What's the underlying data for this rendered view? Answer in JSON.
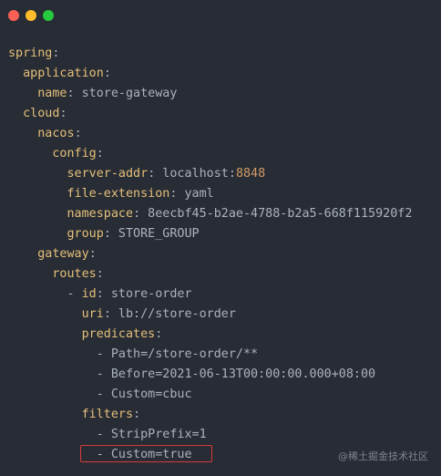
{
  "window": {
    "dots": [
      {
        "name": "close",
        "color": "#ff5f56"
      },
      {
        "name": "minimize",
        "color": "#ffbd2e"
      },
      {
        "name": "maximize",
        "color": "#27c93f"
      }
    ]
  },
  "colors": {
    "background": "#282c34",
    "key": "#e5c07b",
    "number": "#d19a66",
    "text": "#abb2bf",
    "highlight_border": "#d93a3a"
  },
  "code": {
    "lines": [
      {
        "indent": "",
        "parts": [
          {
            "t": "spring",
            "c": "key"
          },
          {
            "t": ":",
            "c": "val"
          }
        ]
      },
      {
        "indent": "  ",
        "parts": [
          {
            "t": "application",
            "c": "key"
          },
          {
            "t": ":",
            "c": "val"
          }
        ]
      },
      {
        "indent": "    ",
        "parts": [
          {
            "t": "name",
            "c": "key"
          },
          {
            "t": ": store-gateway",
            "c": "val"
          }
        ]
      },
      {
        "indent": "  ",
        "parts": [
          {
            "t": "cloud",
            "c": "key"
          },
          {
            "t": ":",
            "c": "val"
          }
        ]
      },
      {
        "indent": "    ",
        "parts": [
          {
            "t": "nacos",
            "c": "key"
          },
          {
            "t": ":",
            "c": "val"
          }
        ]
      },
      {
        "indent": "      ",
        "parts": [
          {
            "t": "config",
            "c": "key"
          },
          {
            "t": ":",
            "c": "val"
          }
        ]
      },
      {
        "indent": "        ",
        "parts": [
          {
            "t": "server-addr",
            "c": "key"
          },
          {
            "t": ": localhost:",
            "c": "val"
          },
          {
            "t": "8848",
            "c": "num"
          }
        ]
      },
      {
        "indent": "        ",
        "parts": [
          {
            "t": "file-extension",
            "c": "key"
          },
          {
            "t": ": yaml",
            "c": "val"
          }
        ]
      },
      {
        "indent": "        ",
        "parts": [
          {
            "t": "namespace",
            "c": "key"
          },
          {
            "t": ": 8eecbf45-b2ae-4788-b2a5-668f115920f2",
            "c": "val"
          }
        ]
      },
      {
        "indent": "        ",
        "parts": [
          {
            "t": "group",
            "c": "key"
          },
          {
            "t": ": STORE_GROUP",
            "c": "val"
          }
        ]
      },
      {
        "indent": "    ",
        "parts": [
          {
            "t": "gateway",
            "c": "key"
          },
          {
            "t": ":",
            "c": "val"
          }
        ]
      },
      {
        "indent": "      ",
        "parts": [
          {
            "t": "routes",
            "c": "key"
          },
          {
            "t": ":",
            "c": "val"
          }
        ]
      },
      {
        "indent": "        ",
        "parts": [
          {
            "t": "- ",
            "c": "val"
          },
          {
            "t": "id",
            "c": "key"
          },
          {
            "t": ": store-order",
            "c": "val"
          }
        ]
      },
      {
        "indent": "          ",
        "parts": [
          {
            "t": "uri",
            "c": "key"
          },
          {
            "t": ": lb://store-order",
            "c": "val"
          }
        ]
      },
      {
        "indent": "          ",
        "parts": [
          {
            "t": "predicates",
            "c": "key"
          },
          {
            "t": ":",
            "c": "val"
          }
        ]
      },
      {
        "indent": "            ",
        "parts": [
          {
            "t": "- Path=/store-order/**",
            "c": "val"
          }
        ]
      },
      {
        "indent": "            ",
        "parts": [
          {
            "t": "- Before=2021-06-13T00:00:00.000+08:00",
            "c": "val"
          }
        ]
      },
      {
        "indent": "            ",
        "parts": [
          {
            "t": "- Custom=cbuc",
            "c": "val"
          }
        ]
      },
      {
        "indent": "          ",
        "parts": [
          {
            "t": "filters",
            "c": "key"
          },
          {
            "t": ":",
            "c": "val"
          }
        ]
      },
      {
        "indent": "            ",
        "parts": [
          {
            "t": "- StripPrefix=1",
            "c": "val"
          }
        ]
      },
      {
        "indent": "            ",
        "parts": [
          {
            "t": "- Custom=true",
            "c": "val"
          }
        ]
      }
    ]
  },
  "watermark": "@稀土掘金技术社区"
}
